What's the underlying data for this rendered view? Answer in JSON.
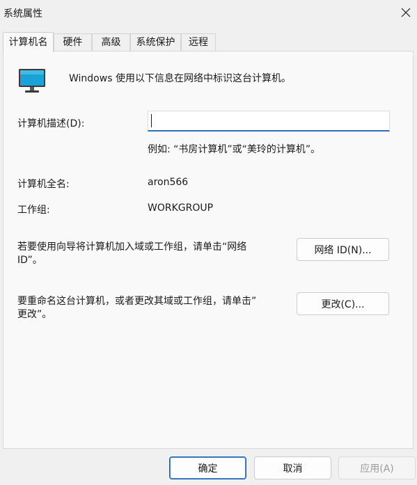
{
  "window": {
    "title": "系统属性"
  },
  "tabs": [
    {
      "label": "计算机名"
    },
    {
      "label": "硬件"
    },
    {
      "label": "高级"
    },
    {
      "label": "系统保护"
    },
    {
      "label": "远程"
    }
  ],
  "intro": {
    "text": "Windows 使用以下信息在网络中标识这台计算机。"
  },
  "description": {
    "label": "计算机描述(D):",
    "value": "",
    "hint": "例如: “书房计算机”或“美玲的计算机”。"
  },
  "full_name": {
    "label": "计算机全名:",
    "value": "aron566"
  },
  "workgroup": {
    "label": "工作组:",
    "value": "WORKGROUP"
  },
  "network_id": {
    "text_line1": "若要使用向导将计算机加入域或工作组，请单击“网络",
    "text_line2": "ID”。",
    "button_label": "网络 ID(N)..."
  },
  "rename": {
    "text_line1": "要重命名这台计算机，或者更改其域或工作组，请单击”",
    "text_line2": "更改”。",
    "button_label": "更改(C)..."
  },
  "footer": {
    "ok_label": "确定",
    "cancel_label": "取消",
    "apply_label": "应用(A)"
  },
  "colors": {
    "accent": "#1f62b5",
    "monitor_screen": "#1aa3d9"
  }
}
